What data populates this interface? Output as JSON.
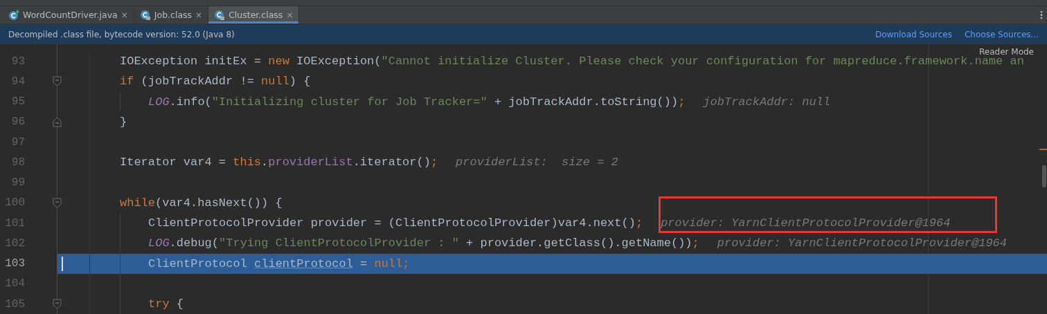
{
  "tabs": [
    {
      "label": "WordCountDriver.java",
      "kind": "source",
      "selected": false,
      "close": "×"
    },
    {
      "label": "Job.class",
      "kind": "compiled",
      "selected": false,
      "close": "×"
    },
    {
      "label": "Cluster.class",
      "kind": "compiled",
      "selected": true,
      "close": "×"
    }
  ],
  "banner": {
    "message": "Decompiled .class file, bytecode version: 52.0 (Java 8)",
    "links": [
      "Download Sources",
      "Choose Sources..."
    ]
  },
  "reader_mode": "Reader Mode",
  "lines": [
    {
      "number": "93",
      "kind": "plain",
      "current": false,
      "tokens": [
        {
          "kind": "plain",
          "text": "IOException initEx = "
        },
        {
          "kind": "keyword",
          "text": "new"
        },
        {
          "kind": "plain",
          "text": " IOException("
        },
        {
          "kind": "string",
          "text": "\"Cannot initialize Cluster. Please check your configuration for mapreduce.framework.name an"
        }
      ]
    },
    {
      "number": "94",
      "kind": "block_start",
      "current": false,
      "tokens": [
        {
          "kind": "keyword",
          "text": "if"
        },
        {
          "kind": "plain",
          "text": " (jobTrackAddr != "
        },
        {
          "kind": "keyword",
          "text": "null"
        },
        {
          "kind": "plain",
          "text": ") {"
        }
      ],
      "children": [
        {
          "number": "95",
          "kind": "plain",
          "current": false,
          "tokens": [
            {
              "kind": "static",
              "text": "LOG"
            },
            {
              "kind": "plain",
              "text": ".info("
            },
            {
              "kind": "string",
              "text": "\"Initializing cluster for Job Tracker=\""
            },
            {
              "kind": "plain",
              "text": " + jobTrackAddr.toString())"
            },
            {
              "kind": "keyword",
              "text": ";"
            }
          ],
          "hint": "jobTrackAddr: null"
        }
      ]
    },
    {
      "number": "96",
      "kind": "block_end",
      "current": false,
      "tokens": [
        {
          "kind": "plain",
          "text": "}"
        }
      ]
    },
    {
      "number": "97",
      "kind": "plain",
      "current": false
    },
    {
      "number": "98",
      "kind": "plain",
      "current": false,
      "tokens": [
        {
          "kind": "plain",
          "text": "Iterator var4 = "
        },
        {
          "kind": "keyword",
          "text": "this"
        },
        {
          "kind": "plain",
          "text": "."
        },
        {
          "kind": "field",
          "text": "providerList"
        },
        {
          "kind": "plain",
          "text": ".iterator()"
        },
        {
          "kind": "keyword",
          "text": ";"
        }
      ],
      "hint": "providerList:  size = 2"
    },
    {
      "number": "99",
      "kind": "plain",
      "current": false
    },
    {
      "number": "100",
      "kind": "block_start",
      "current": false,
      "tokens": [
        {
          "kind": "keyword",
          "text": "while"
        },
        {
          "kind": "plain",
          "text": "(var4.hasNext()) {"
        }
      ],
      "children": [
        {
          "number": "101",
          "kind": "plain",
          "current": false,
          "tokens": [
            {
              "kind": "plain",
              "text": "ClientProtocolProvider provider = (ClientProtocolProvider)var4.next()"
            },
            {
              "kind": "keyword",
              "text": ";"
            }
          ],
          "hint": "provider: YarnClientProtocolProvider@1964"
        },
        {
          "number": "102",
          "kind": "plain",
          "current": false,
          "tokens": [
            {
              "kind": "static",
              "text": "LOG"
            },
            {
              "kind": "plain",
              "text": ".debug("
            },
            {
              "kind": "string",
              "text": "\"Trying ClientProtocolProvider : \""
            },
            {
              "kind": "plain",
              "text": " + provider.getClass().getName())"
            },
            {
              "kind": "keyword",
              "text": ";"
            }
          ],
          "hint": "provider: YarnClientProtocolProvider@1964"
        },
        {
          "number": "103",
          "kind": "plain",
          "current": true,
          "tokens": [
            {
              "kind": "plain",
              "text": "ClientProtocol "
            },
            {
              "kind": "unused",
              "text": "clientProtocol"
            },
            {
              "kind": "plain",
              "text": " = "
            },
            {
              "kind": "keyword",
              "text": "null;"
            }
          ]
        },
        {
          "number": "104",
          "kind": "plain",
          "current": false
        },
        {
          "number": "105",
          "kind": "block_start",
          "current": false,
          "tokens": [
            {
              "kind": "keyword",
              "text": "try"
            },
            {
              "kind": "plain",
              "text": " {"
            }
          ]
        }
      ]
    }
  ]
}
